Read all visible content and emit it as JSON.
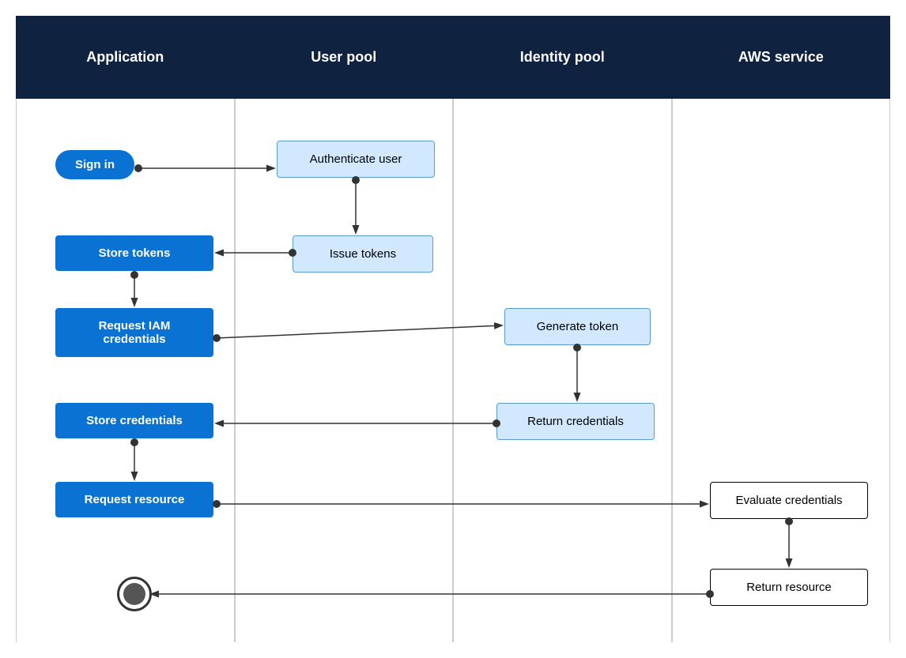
{
  "columns": [
    {
      "id": "application",
      "label": "Application"
    },
    {
      "id": "user-pool",
      "label": "User pool"
    },
    {
      "id": "identity-pool",
      "label": "Identity pool"
    },
    {
      "id": "aws-service",
      "label": "AWS service"
    }
  ],
  "nodes": {
    "sign_in": "Sign in",
    "authenticate_user": "Authenticate user",
    "store_tokens": "Store tokens",
    "issue_tokens": "Issue tokens",
    "request_iam": "Request IAM\ncredentials",
    "generate_token": "Generate token",
    "store_credentials": "Store credentials",
    "return_credentials": "Return credentials",
    "request_resource": "Request resource",
    "evaluate_credentials": "Evaluate credentials",
    "return_resource": "Return resource"
  }
}
